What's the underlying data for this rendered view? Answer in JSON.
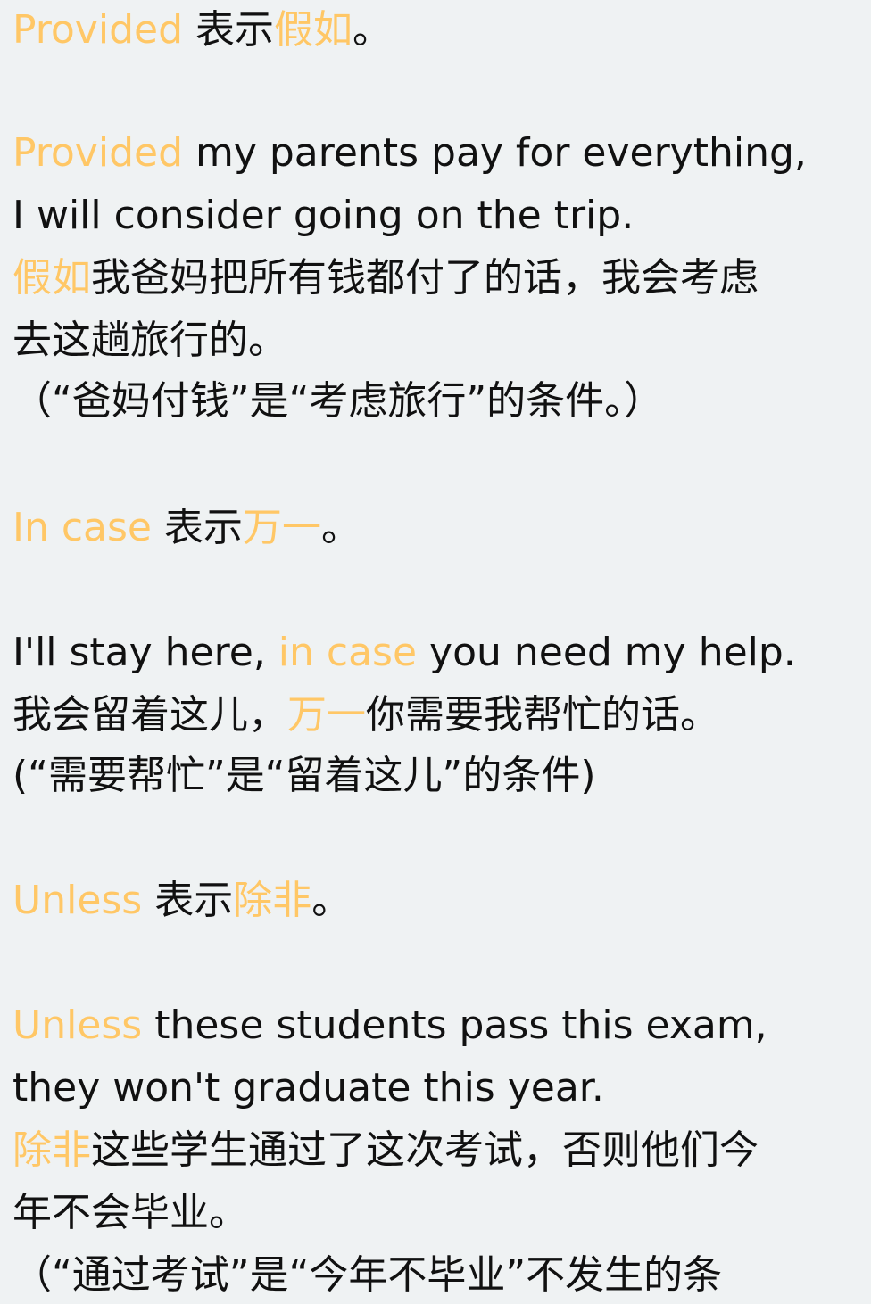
{
  "sections": [
    {
      "heading": {
        "term": "Provided",
        "text": " 表示",
        "meaning": "假如",
        "end": "。"
      },
      "example": {
        "en_line1": {
          "term": "Provided",
          "rest": " my parents pay for everything,"
        },
        "en_line2": "I will consider going on the trip.",
        "zh_line1": {
          "term": "假如",
          "rest": "我爸妈把所有钱都付了的话，我会考虑"
        },
        "zh_line2": "去这趟旅行的。",
        "note": "（“爸妈付钱”是“考虑旅行”的条件。）"
      }
    },
    {
      "heading": {
        "term": "In case",
        "text": " 表示",
        "meaning": "万一",
        "end": "。"
      },
      "example": {
        "en_line1": {
          "before": "I'll stay here, ",
          "term": "in case",
          "rest": " you need my help."
        },
        "zh_line1": {
          "before": "我会留着这儿，",
          "term": "万一",
          "rest": "你需要我帮忙的话。"
        },
        "note": "(“需要帮忙”是“留着这儿”的条件)"
      }
    },
    {
      "heading": {
        "term": "Unless",
        "text": " 表示",
        "meaning": "除非",
        "end": "。"
      },
      "example": {
        "en_line1": {
          "term": "Unless",
          "rest": " these students pass this exam,"
        },
        "en_line2": "they won't graduate this year.",
        "zh_line1": {
          "term": "除非",
          "rest": "这些学生通过了这次考试，否则他们今"
        },
        "zh_line2": "年不会毕业。",
        "note": "（“通过考试”是“今年不毕业”不发生的条"
      }
    }
  ],
  "colors": {
    "highlight": "#ffc766",
    "text": "#111111",
    "background": "#eff2f3"
  }
}
